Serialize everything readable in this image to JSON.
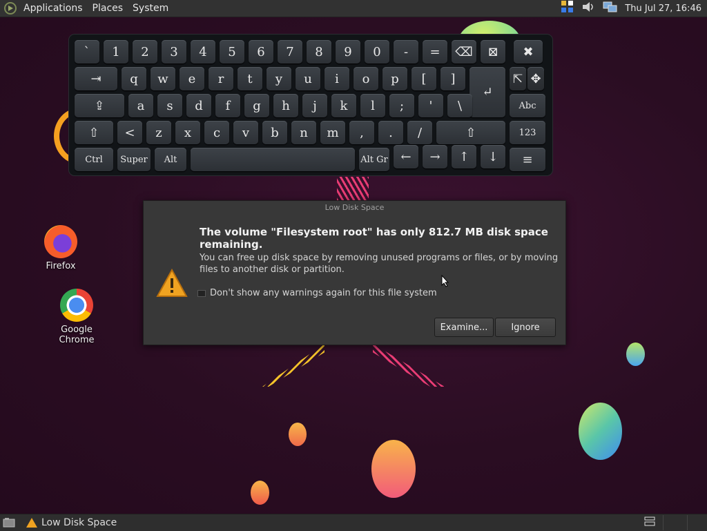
{
  "top_panel": {
    "menus": [
      "Applications",
      "Places",
      "System"
    ],
    "clock": "Thu Jul 27, 16:46",
    "tray_icons": [
      "indicator-icon",
      "volume-icon",
      "network-icon"
    ]
  },
  "keyboard": {
    "row1": [
      "`",
      "1",
      "2",
      "3",
      "4",
      "5",
      "6",
      "7",
      "8",
      "9",
      "0",
      "-",
      "=",
      "⌫",
      "⊠",
      "✖"
    ],
    "row2": [
      "⇥",
      "q",
      "w",
      "e",
      "r",
      "t",
      "y",
      "u",
      "i",
      "o",
      "p",
      "[",
      "]",
      "↵",
      "⇱",
      "✥"
    ],
    "row3": [
      "⇪",
      "a",
      "s",
      "d",
      "f",
      "g",
      "h",
      "j",
      "k",
      "l",
      ";",
      "'",
      "\\",
      "Abc"
    ],
    "row4": [
      "⇧",
      "<",
      "z",
      "x",
      "c",
      "v",
      "b",
      "n",
      "m",
      ",",
      ".",
      "/",
      "⇧",
      "123"
    ],
    "row5": [
      "Ctrl",
      "Super",
      "Alt",
      "",
      "Alt Gr",
      "←",
      "→",
      "↑",
      "↓",
      "≡"
    ]
  },
  "desktop_icons": [
    {
      "label": "Firefox"
    },
    {
      "label": "Google Chrome"
    }
  ],
  "dialog": {
    "title": "Low Disk Space",
    "heading": "The volume \"Filesystem root\" has only 812.7 MB disk space remaining.",
    "body": "You can free up disk space by removing unused programs or files, or by moving files to another disk or partition.",
    "checkbox_label": "Don't show any warnings again for this file system",
    "checkbox_checked": false,
    "examine_label": "Examine...",
    "ignore_label": "Ignore"
  },
  "taskbar": {
    "window_label": "Low Disk Space"
  },
  "colors": {
    "panel": "#323232",
    "dialog_bg": "#383838",
    "warning": "#f0a321",
    "wallpaper": "#2a0f24"
  }
}
